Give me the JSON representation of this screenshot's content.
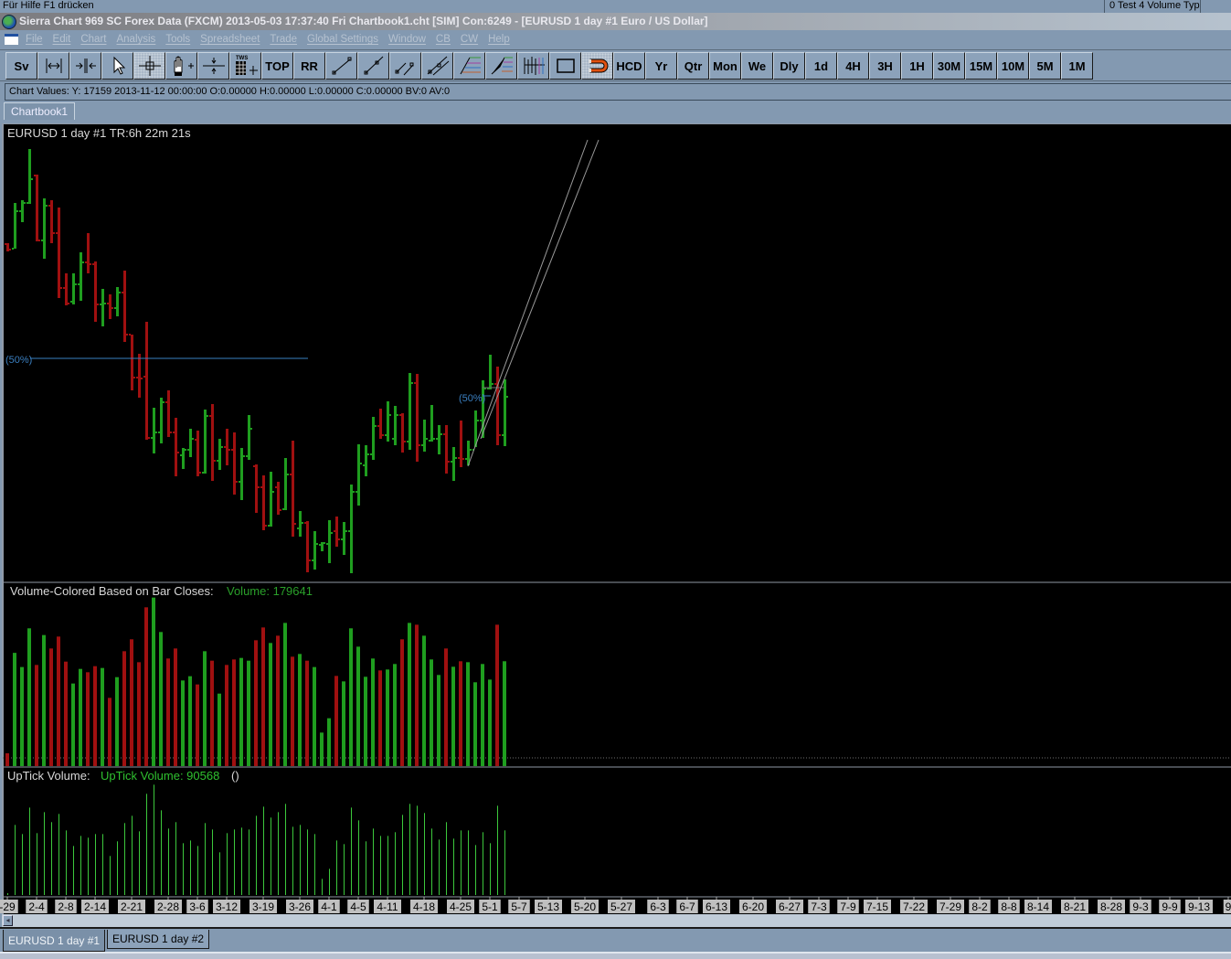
{
  "status_hint": "Für Hilfe F1 drücken",
  "top_right_box": "0 Test 4 Volume Typ",
  "title": "Sierra Chart 969 SC Forex Data (FXCM) 2013-05-03  17:37:40 Fri  Chartbook1.cht [SIM] Con:6249 - [EURUSD  1 day   #1  Euro / US Dollar]",
  "menu": [
    "File",
    "Edit",
    "Chart",
    "Analysis",
    "Tools",
    "Spreadsheet",
    "Trade",
    "Global Settings",
    "Window",
    "CB",
    "CW",
    "Help"
  ],
  "toolbar": {
    "buttons": [
      {
        "label": "Sv"
      },
      {
        "icon": "zoom-horizontal-icon"
      },
      {
        "icon": "compress-icon"
      },
      {
        "icon": "pointer-icon"
      },
      {
        "icon": "crosshair-icon",
        "pressed": true
      },
      {
        "icon": "hand-pan-icon"
      },
      {
        "icon": "values-line-icon"
      },
      {
        "icon": "tws-grid-icon"
      },
      {
        "label": "TOP"
      },
      {
        "label": "RR"
      },
      {
        "icon": "line-icon"
      },
      {
        "icon": "ray-icon"
      },
      {
        "icon": "parallel-lines-icon"
      },
      {
        "icon": "channel-icon"
      },
      {
        "icon": "fib-retracement-icon"
      },
      {
        "icon": "fib-extension-icon"
      },
      {
        "icon": "bar-tool-icon"
      },
      {
        "icon": "rectangle-icon"
      },
      {
        "icon": "magnet-icon",
        "pressed": true
      },
      {
        "label": "HCD"
      },
      {
        "label": "Yr"
      },
      {
        "label": "Qtr"
      },
      {
        "label": "Mon"
      },
      {
        "label": "We"
      },
      {
        "label": "Dly"
      },
      {
        "label": "1d"
      },
      {
        "label": "4H"
      },
      {
        "label": "3H"
      },
      {
        "label": "1H"
      },
      {
        "label": "30M"
      },
      {
        "label": "15M"
      },
      {
        "label": "10M"
      },
      {
        "label": "5M"
      },
      {
        "label": "1M"
      }
    ]
  },
  "chart_values": "Chart Values: Y: 17159  2013-11-12  00:00:00  O:0.00000  H:0.00000  L:0.00000  C:0.00000  BV:0  AV:0",
  "chartbook_tab": "Chartbook1",
  "price_panel": {
    "header": "EURUSD  1 day   #1 TR:6h 22m 21s",
    "fib_label_1": "(50%)",
    "fib_label_2": "(50%)"
  },
  "volume_panel": {
    "label": "Volume-Colored Based on Bar Closes:",
    "value_label": "Volume: 179641"
  },
  "uptick_panel": {
    "label": "UpTick Volume:",
    "value_label": "UpTick Volume: 90568",
    "suffix": "()"
  },
  "bottom_tabs": [
    "EURUSD  1 day   #1",
    "EURUSD  1 day   #2"
  ],
  "colors": {
    "up": "#1f9e1f",
    "down": "#a01010",
    "uptick": "#3cc83c",
    "fib": "#3a7fc0",
    "axis_label_bg": "#c0c0c0"
  },
  "chart_data": {
    "type": "ohlc",
    "symbol": "EURUSD",
    "ylim": [
      1.27,
      1.376
    ],
    "x_labels": [
      {
        "label": "-29",
        "index": 0
      },
      {
        "label": "2-4",
        "index": 4
      },
      {
        "label": "2-8",
        "index": 8
      },
      {
        "label": "2-14",
        "index": 12
      },
      {
        "label": "2-21",
        "index": 17
      },
      {
        "label": "2-28",
        "index": 22
      },
      {
        "label": "3-6",
        "index": 26
      },
      {
        "label": "3-12",
        "index": 30
      },
      {
        "label": "3-19",
        "index": 35
      },
      {
        "label": "3-26",
        "index": 40
      },
      {
        "label": "4-1",
        "index": 44
      },
      {
        "label": "4-5",
        "index": 48
      },
      {
        "label": "4-11",
        "index": 52
      },
      {
        "label": "4-18",
        "index": 57
      },
      {
        "label": "4-25",
        "index": 62
      },
      {
        "label": "5-1",
        "index": 66
      },
      {
        "label": "5-7",
        "index": 70
      },
      {
        "label": "5-13",
        "index": 74
      },
      {
        "label": "5-20",
        "index": 79
      },
      {
        "label": "5-27",
        "index": 84
      },
      {
        "label": "6-3",
        "index": 89
      },
      {
        "label": "6-7",
        "index": 93
      },
      {
        "label": "6-13",
        "index": 97
      },
      {
        "label": "6-20",
        "index": 102
      },
      {
        "label": "6-27",
        "index": 107
      },
      {
        "label": "7-3",
        "index": 111
      },
      {
        "label": "7-9",
        "index": 115
      },
      {
        "label": "7-15",
        "index": 119
      },
      {
        "label": "7-22",
        "index": 124
      },
      {
        "label": "7-29",
        "index": 129
      },
      {
        "label": "8-2",
        "index": 133
      },
      {
        "label": "8-8",
        "index": 137
      },
      {
        "label": "8-14",
        "index": 141
      },
      {
        "label": "8-21",
        "index": 146
      },
      {
        "label": "8-28",
        "index": 151
      },
      {
        "label": "9-3",
        "index": 155
      },
      {
        "label": "9-9",
        "index": 159
      },
      {
        "label": "9-13",
        "index": 163
      },
      {
        "label": "9",
        "index": 167
      }
    ],
    "ohlc": [
      [
        1.3492,
        1.3494,
        1.3476,
        1.348
      ],
      [
        1.3482,
        1.3582,
        1.3482,
        1.3564
      ],
      [
        1.3564,
        1.3588,
        1.354,
        1.3582
      ],
      [
        1.3582,
        1.37,
        1.358,
        1.3634
      ],
      [
        1.3642,
        1.3644,
        1.3498,
        1.35
      ],
      [
        1.35,
        1.3592,
        1.346,
        1.3576
      ],
      [
        1.3576,
        1.3588,
        1.3494,
        1.3516
      ],
      [
        1.3516,
        1.3572,
        1.3374,
        1.3396
      ],
      [
        1.3396,
        1.3428,
        1.3358,
        1.3362
      ],
      [
        1.3366,
        1.3428,
        1.336,
        1.3404
      ],
      [
        1.3404,
        1.3474,
        1.3368,
        1.3452
      ],
      [
        1.3452,
        1.3516,
        1.3428,
        1.3448
      ],
      [
        1.3448,
        1.3454,
        1.3322,
        1.336
      ],
      [
        1.336,
        1.3394,
        1.3312,
        1.3362
      ],
      [
        1.3362,
        1.3382,
        1.3328,
        1.3352
      ],
      [
        1.3352,
        1.3398,
        1.3334,
        1.3386
      ],
      [
        1.3386,
        1.3434,
        1.3278,
        1.3294
      ],
      [
        1.3294,
        1.3294,
        1.3172,
        1.32
      ],
      [
        1.32,
        1.3252,
        1.3156,
        1.3198
      ],
      [
        1.3202,
        1.3322,
        1.3064,
        1.3068
      ],
      [
        1.3068,
        1.3134,
        1.3034,
        1.308
      ],
      [
        1.308,
        1.3156,
        1.3056,
        1.3146
      ],
      [
        1.3146,
        1.3172,
        1.307,
        1.308
      ],
      [
        1.308,
        1.3112,
        1.2984,
        1.3036
      ],
      [
        1.303,
        1.3046,
        1.3,
        1.3042
      ],
      [
        1.3042,
        1.3088,
        1.3026,
        1.3066
      ],
      [
        1.3064,
        1.3084,
        1.2984,
        1.2992
      ],
      [
        1.2992,
        1.313,
        1.299,
        1.3116
      ],
      [
        1.3116,
        1.3142,
        1.2974,
        1.3018
      ],
      [
        1.3018,
        1.3066,
        1.2998,
        1.3048
      ],
      [
        1.3048,
        1.3088,
        1.3008,
        1.3042
      ],
      [
        1.3042,
        1.308,
        1.2944,
        1.2972
      ],
      [
        1.2972,
        1.3046,
        1.2932,
        1.3028
      ],
      [
        1.3028,
        1.3118,
        1.302,
        1.3088
      ],
      [
        1.3006,
        1.301,
        1.2904,
        1.296
      ],
      [
        1.296,
        1.2986,
        1.2866,
        1.2876
      ],
      [
        1.2876,
        1.2994,
        1.2874,
        1.295
      ],
      [
        1.296,
        1.2972,
        1.29,
        1.291
      ],
      [
        1.2912,
        1.3024,
        1.291,
        1.2988
      ],
      [
        1.2988,
        1.3062,
        1.2852,
        1.288
      ],
      [
        1.287,
        1.2908,
        1.2852,
        1.2882
      ],
      [
        1.2882,
        1.2886,
        1.2774,
        1.28
      ],
      [
        1.28,
        1.2864,
        1.278,
        1.2836
      ],
      [
        1.2834,
        1.284,
        1.282,
        1.2838
      ],
      [
        1.2836,
        1.2888,
        1.2794,
        1.286
      ],
      [
        1.2864,
        1.2896,
        1.283,
        1.2846
      ],
      [
        1.2846,
        1.2884,
        1.2812,
        1.2864
      ],
      [
        1.2864,
        1.2966,
        1.2772,
        1.295
      ],
      [
        1.295,
        1.3054,
        1.292,
        1.3012
      ],
      [
        1.3008,
        1.3052,
        1.2984,
        1.3032
      ],
      [
        1.3032,
        1.3114,
        1.302,
        1.3094
      ],
      [
        1.3094,
        1.3132,
        1.3066,
        1.3074
      ],
      [
        1.3074,
        1.3148,
        1.306,
        1.3118
      ],
      [
        1.3066,
        1.3138,
        1.3052,
        1.3118
      ],
      [
        1.3118,
        1.3122,
        1.3036,
        1.306
      ],
      [
        1.306,
        1.321,
        1.3042,
        1.3188
      ],
      [
        1.3188,
        1.3208,
        1.3016,
        1.3052
      ],
      [
        1.3052,
        1.3108,
        1.3038,
        1.3066
      ],
      [
        1.3062,
        1.314,
        1.306,
        1.3066
      ],
      [
        1.3066,
        1.3096,
        1.3032,
        1.3076
      ],
      [
        1.3076,
        1.3096,
        1.299,
        1.3016
      ],
      [
        1.3016,
        1.3048,
        1.2974,
        1.3024
      ],
      [
        1.3024,
        1.3106,
        1.3004,
        1.3022
      ],
      [
        1.3022,
        1.3062,
        1.3008,
        1.3042
      ],
      [
        1.3042,
        1.3128,
        1.3048,
        1.3106
      ],
      [
        1.3106,
        1.3194,
        1.3068,
        1.3176
      ],
      [
        1.3176,
        1.325,
        1.3174,
        1.3186
      ],
      [
        1.3186,
        1.3224,
        1.3052,
        1.3074
      ],
      [
        1.3074,
        1.3196,
        1.305,
        1.3158
      ]
    ],
    "volume": [
      22000,
      194000,
      169700,
      236000,
      173300,
      224500,
      201500,
      221900,
      179000,
      141500,
      166500,
      160800,
      171200,
      168100,
      116900,
      152400,
      196800,
      217200,
      178000,
      272000,
      288700,
      229700,
      184300,
      201500,
      146700,
      154000,
      139900,
      196800,
      180600,
      124200,
      173300,
      182700,
      185300,
      180600,
      215600,
      237500,
      210900,
      223400,
      245300,
      187400,
      192100,
      180600,
      169700,
      57400,
      82000,
      154500,
      145100,
      236000,
      204600,
      153000,
      184300,
      163900,
      165500,
      174900,
      217200,
      245300,
      242200,
      223400,
      182700,
      156100,
      201500,
      170200,
      179600,
      178000,
      143600,
      174900,
      148200,
      242200,
      179641
    ],
    "uptick_volume": [
      2600,
      98200,
      85400,
      122500,
      86700,
      116100,
      102100,
      113600,
      90500,
      68700,
      82800,
      80300,
      85400,
      85400,
      54700,
      75200,
      100800,
      111000,
      89200,
      141800,
      154600,
      118700,
      93100,
      102100,
      72600,
      76400,
      68700,
      100800,
      91800,
      59800,
      86700,
      91800,
      94400,
      91800,
      111000,
      123800,
      108500,
      116100,
      127700,
      95600,
      98200,
      91800,
      85400,
      22600,
      36700,
      76400,
      71300,
      122500,
      104600,
      75200,
      93100,
      82800,
      82800,
      88000,
      112300,
      127700,
      125100,
      114900,
      93100,
      77700,
      102100,
      79000,
      90500,
      90500,
      70000,
      88000,
      72600,
      125100,
      90568
    ]
  }
}
